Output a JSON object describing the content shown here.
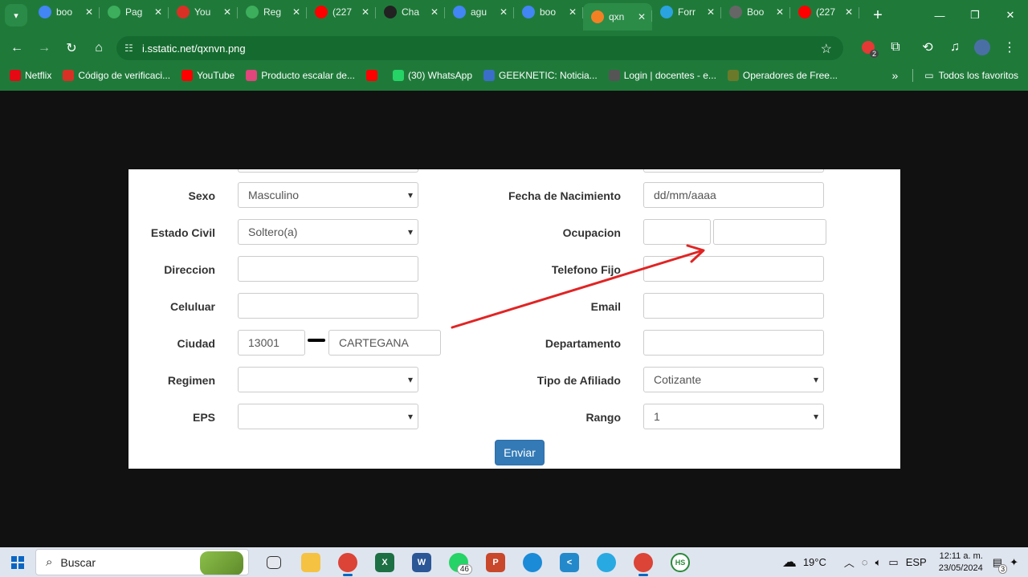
{
  "browser": {
    "tabs": [
      {
        "title": "boo",
        "icon": "google-icon",
        "color": "#4285f4"
      },
      {
        "title": "Pag",
        "icon": "cube-icon",
        "color": "#3cae5c"
      },
      {
        "title": "You",
        "icon": "gmail-icon",
        "color": "#d93025"
      },
      {
        "title": "Reg",
        "icon": "cube-icon",
        "color": "#3cae5c"
      },
      {
        "title": "(227",
        "icon": "youtube-icon",
        "color": "#ff0000"
      },
      {
        "title": "Cha",
        "icon": "chatgpt-icon",
        "color": "#222222"
      },
      {
        "title": "agu",
        "icon": "google-icon",
        "color": "#4285f4"
      },
      {
        "title": "boo",
        "icon": "google-icon",
        "color": "#4285f4"
      },
      {
        "title": "qxn",
        "icon": "stackoverflow-icon",
        "color": "#f48024",
        "active": true
      },
      {
        "title": "Forr",
        "icon": "forms-icon",
        "color": "#2aa3e0"
      },
      {
        "title": "Boo",
        "icon": "doc-icon",
        "color": "#666666"
      },
      {
        "title": "(227",
        "icon": "youtube-icon",
        "color": "#ff0000"
      }
    ],
    "url": "i.sstatic.net/qxnvn.png",
    "bookmarks": [
      {
        "label": "Netflix",
        "icon": "netflix-icon",
        "color": "#e50914"
      },
      {
        "label": "Código de verificaci...",
        "icon": "gmail-icon",
        "color": "#d93025"
      },
      {
        "label": "YouTube",
        "icon": "youtube-icon",
        "color": "#ff0000"
      },
      {
        "label": "Producto escalar de...",
        "icon": "pink-icon",
        "color": "#e0457b"
      },
      {
        "label": "",
        "icon": "youtube-icon",
        "color": "#ff0000"
      },
      {
        "label": "(30) WhatsApp",
        "icon": "whatsapp-icon",
        "color": "#25d366"
      },
      {
        "label": "GEEKNETIC: Noticia...",
        "icon": "geeknetic-icon",
        "color": "#3a6ec9"
      },
      {
        "label": "Login | docentes - e...",
        "icon": "globe-icon",
        "color": "#555555"
      },
      {
        "label": "Operadores de Free...",
        "icon": "game-icon",
        "color": "#6b7a2a"
      }
    ],
    "all_bookmarks": "Todos los favoritos"
  },
  "form": {
    "left": [
      {
        "label": "Sexo",
        "value": "Masculino",
        "type": "select"
      },
      {
        "label": "Estado Civil",
        "value": "Soltero(a)",
        "type": "select"
      },
      {
        "label": "Direccion",
        "value": "",
        "type": "text"
      },
      {
        "label": "Celuluar",
        "value": "",
        "type": "text"
      },
      {
        "label": "Ciudad",
        "code": "13001",
        "value": "CARTEGANA",
        "type": "split"
      },
      {
        "label": "Regimen",
        "value": "",
        "type": "select"
      },
      {
        "label": "EPS",
        "value": "",
        "type": "select"
      }
    ],
    "right": [
      {
        "label": "Fecha de Nacimiento",
        "value": "dd/mm/aaaa",
        "type": "text"
      },
      {
        "label": "Ocupacion",
        "value": "",
        "type": "split"
      },
      {
        "label": "Telefono Fijo",
        "value": "",
        "type": "text"
      },
      {
        "label": "Email",
        "value": "",
        "type": "text"
      },
      {
        "label": "Departamento",
        "value": "",
        "type": "text"
      },
      {
        "label": "Tipo de Afiliado",
        "value": "Cotizante",
        "type": "select"
      },
      {
        "label": "Rango",
        "value": "1",
        "type": "select"
      }
    ],
    "submit": "Enviar"
  },
  "taskbar": {
    "search": "Buscar",
    "whatsapp_badge": "46",
    "weather": "19°C",
    "language": "ESP",
    "time": "12:11 a. m.",
    "date": "23/05/2024",
    "notifications": "3",
    "extension_badge": "2"
  }
}
